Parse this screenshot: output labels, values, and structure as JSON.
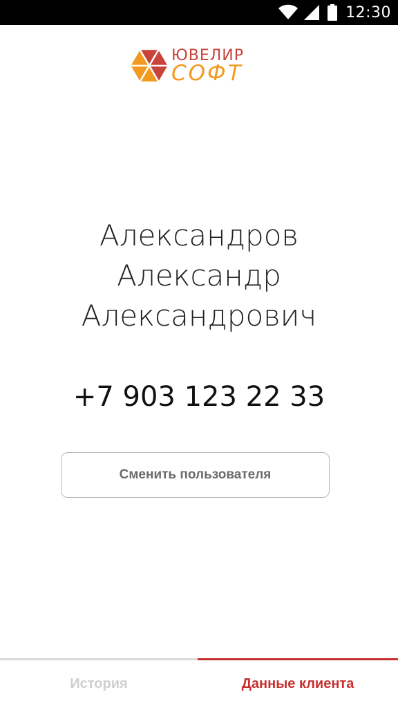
{
  "status_bar": {
    "time": "12:30",
    "icons": [
      "wifi-icon",
      "signal-icon",
      "battery-icon"
    ]
  },
  "logo": {
    "line1": "ЮВЕЛИР",
    "line2": "СОФТ",
    "colors": {
      "red": "#c8433a",
      "orange": "#f29a1f"
    }
  },
  "client": {
    "name_lines": [
      "Александров",
      "Александр",
      "Александрович"
    ],
    "phone": "+7 903 123 22 33"
  },
  "actions": {
    "switch_user_label": "Сменить пользователя"
  },
  "tabs": [
    {
      "label": "История",
      "active": false
    },
    {
      "label": "Данные клиента",
      "active": true
    }
  ],
  "colors": {
    "accent": "#c62f2f",
    "inactive_tab": "#cfcfcf",
    "button_border": "#b8b8b8"
  }
}
